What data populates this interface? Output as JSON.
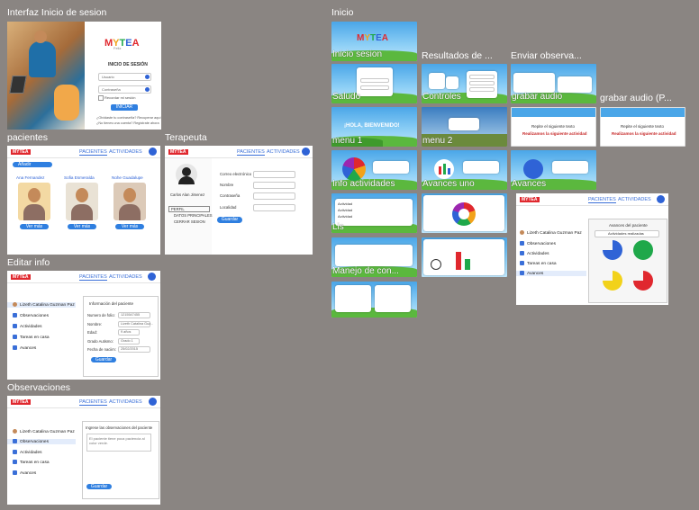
{
  "canvas_bg": "#8a8582",
  "labels": {
    "login": "Interfaz Inicio de sesion",
    "inicio": "Inicio",
    "resultados": "Resultados de ...",
    "enviar": "Enviar observa...",
    "grabar": "grabar audio (P...",
    "pacientes": "pacientes",
    "terapeuta": "Terapeuta",
    "editar": "Editar info",
    "observaciones": "Observaciones"
  },
  "overlays": {
    "inicio_sesion": "Inicio sesion",
    "saludo": "Saludo",
    "controles": "Controles",
    "grabar_audio": "grabar audio",
    "menu1": "menu 1",
    "menu2": "menu 2",
    "info_act": "Info actividades",
    "avances_uno": "Avances uno",
    "avances": "Avances",
    "lis": "Lis",
    "manejo": "Manejo de con..."
  },
  "login": {
    "logo": "MYTEA",
    "sub": "Feliz",
    "title": "INICIO DE SESIÓN",
    "user_ph": "Usuario",
    "pass_ph": "Contraseña",
    "remember": "Recordar mi sesión",
    "button": "INICIAR",
    "forgot": "¿Olvidaste tu contraseña? Recuperar aquí",
    "register": "¿No tienes una cuenta? Regístrate ahora"
  },
  "patients": {
    "tabs": [
      "PACIENTES",
      "ACTIVIDADES"
    ],
    "add": "Añadir",
    "cards": [
      {
        "name": "Ana Fernandez",
        "btn": "Ver más"
      },
      {
        "name": "Sofia Esmeralda",
        "btn": "Ver más"
      },
      {
        "name": "Nohe Guadalupe",
        "btn": "Ver más"
      }
    ]
  },
  "therapist": {
    "tabs": [
      "PACIENTES",
      "ACTIVIDADES"
    ],
    "name": "Carlos Alan Jimenez",
    "menu": [
      "PERFIL",
      "DATOS PRINCIPALES",
      "CERRAR SESION"
    ],
    "fields": [
      "Correo electrónico",
      "Nombre",
      "Contraseña",
      "Localidad"
    ],
    "save": "Guardar"
  },
  "edit": {
    "tabs": [
      "PACIENTES",
      "ACTIVIDADES"
    ],
    "patient": "Lizeth Catalina Guzman Paz",
    "menu": [
      "Observaciones",
      "Actividades",
      "Tareas en casa",
      "Avances"
    ],
    "title": "Información del paciente",
    "fields": [
      {
        "label": "Numero de folio:",
        "value": "1215547455"
      },
      {
        "label": "Nombre:",
        "value": "Lizeth Catalina Guz..."
      },
      {
        "label": "Edad:",
        "value": "9 años"
      },
      {
        "label": "Grado Autismo:",
        "value": "Grado 1"
      },
      {
        "label": "Fecha de naciim:",
        "value": "25/02/2015"
      }
    ],
    "save": "Guardar"
  },
  "obs": {
    "tabs": [
      "PACIENTES",
      "ACTIVIDADES"
    ],
    "patient": "Lizeth Catalina Guzman Paz",
    "menu": [
      "Observaciones",
      "Actividades",
      "Tareas en casa",
      "Avances"
    ],
    "title": "Ingrese las observaciones del paciente",
    "text": "El paciente tiene poca paciencia al color verde.",
    "save": "Guardar"
  },
  "progress": {
    "tabs": [
      "PACIENTES",
      "ACTIVIDADES"
    ],
    "patient": "Lizeth Catalina Guzman Paz",
    "menu": [
      "Observaciones",
      "Actividades",
      "Tareas en casa",
      "Avances"
    ],
    "title": "Avances del paciente",
    "select": "Actividades realizadas",
    "pies": [
      {
        "fill": 0.75,
        "color": "#2f63d6"
      },
      {
        "fill": 1.0,
        "color": "#1fa84a"
      },
      {
        "fill": 0.75,
        "color": "#f2d21a"
      },
      {
        "fill": 0.75,
        "color": "#e0282e"
      }
    ]
  },
  "mini": {
    "hola": "¡HOLA, BIENVENIDO!",
    "repite": "Repite el siguiente texto",
    "realiza": "Realizamos la siguiente actividad",
    "actividad": "Actividad"
  },
  "colors": {
    "accent": "#2f63d6",
    "sky": "#4aa6e8",
    "grass": "#5bb83e",
    "button": "#2f7fe0"
  }
}
